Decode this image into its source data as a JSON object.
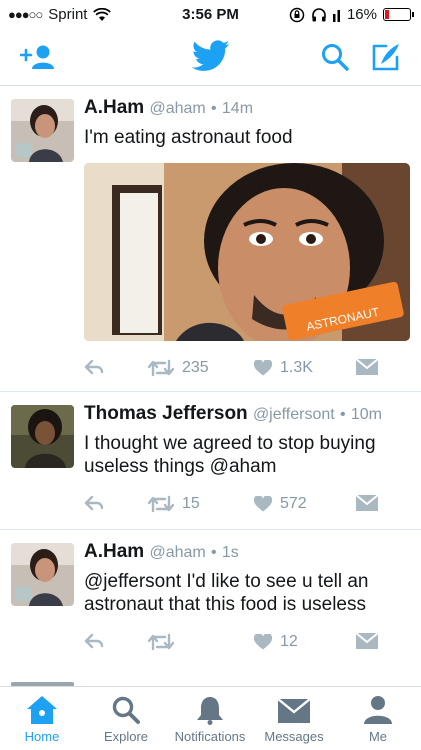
{
  "status_bar": {
    "carrier": "Sprint",
    "time": "3:56 PM",
    "battery_percent": "16%",
    "battery_level": 0.16,
    "signal_dots": "●●●○○"
  },
  "nav": {
    "add_user_icon": "add-user-icon",
    "logo": "twitter-bird-logo",
    "search_icon": "search-icon",
    "compose_icon": "compose-icon",
    "accent": "#1da1f2"
  },
  "tweets": [
    {
      "name": "A.Ham",
      "handle": "@aham",
      "time": "14m",
      "text": "I'm eating astronaut food",
      "media_text": "ASTRONAUT",
      "retweets": "235",
      "likes": "1.3K"
    },
    {
      "name": "Thomas Jefferson",
      "handle": "@jeffersont",
      "time": "10m",
      "text": "I thought we agreed to stop buying useless things @aham",
      "retweets": "15",
      "likes": "572"
    },
    {
      "name": "A.Ham",
      "handle": "@aham",
      "time": "1s",
      "text": "@jeffersont I'd like to see u tell an astronaut that this food is useless",
      "retweets": "",
      "likes": "12"
    }
  ],
  "tabs": [
    {
      "label": "Home",
      "icon": "home-icon",
      "active": true
    },
    {
      "label": "Explore",
      "icon": "search-icon"
    },
    {
      "label": "Notifications",
      "icon": "bell-icon"
    },
    {
      "label": "Messages",
      "icon": "envelope-icon"
    },
    {
      "label": "Me",
      "icon": "person-icon"
    }
  ]
}
